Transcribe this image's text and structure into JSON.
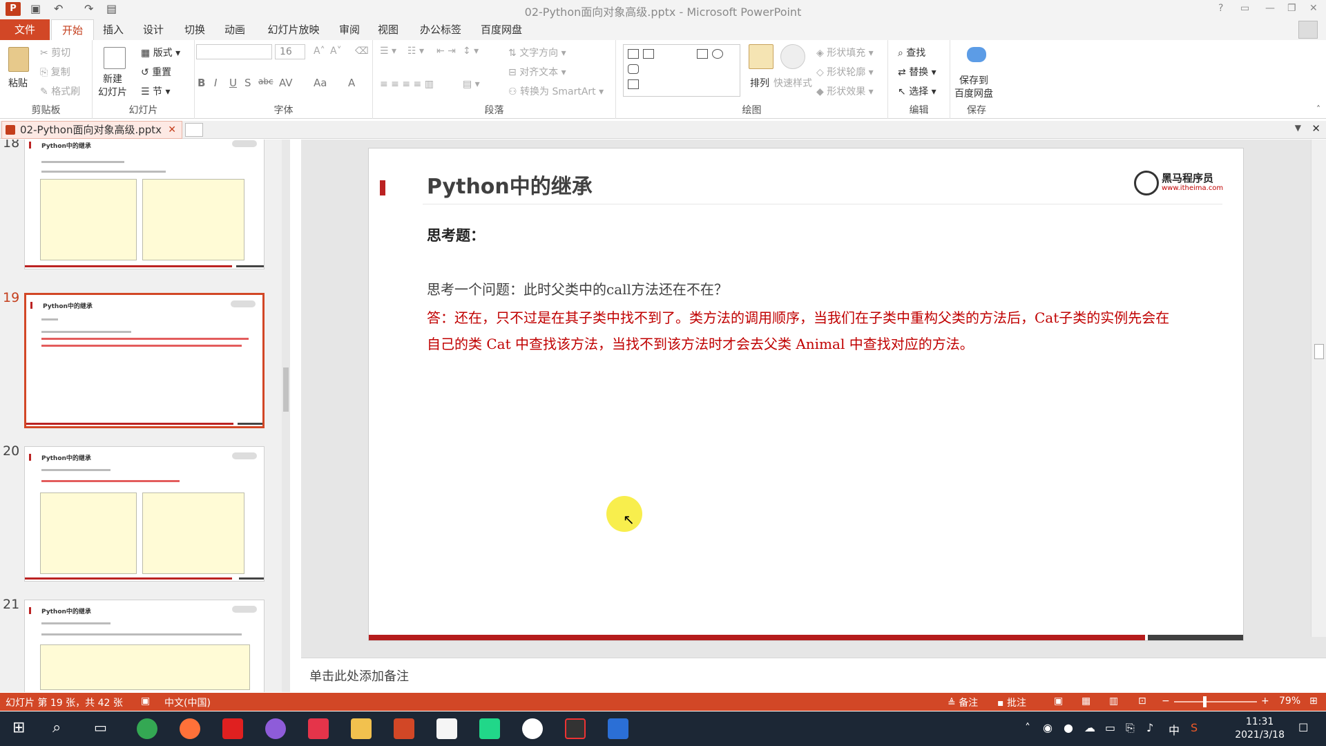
{
  "window": {
    "title": "02-Python面向对象高级.pptx - Microsoft PowerPoint",
    "help": "?"
  },
  "tabs": [
    "文件",
    "开始",
    "插入",
    "设计",
    "切换",
    "动画",
    "幻灯片放映",
    "审阅",
    "视图",
    "办公标签",
    "百度网盘"
  ],
  "ribbon": {
    "clipboard": {
      "paste": "粘贴",
      "cut": "剪切",
      "copy": "复制",
      "format_painter": "格式刷",
      "label": "剪贴板"
    },
    "slides": {
      "new_slide": "新建\n幻灯片",
      "layout": "版式",
      "reset": "重置",
      "section": "节",
      "label": "幻灯片"
    },
    "font": {
      "size": "16",
      "label": "字体",
      "bold": "B",
      "italic": "I",
      "underline": "U",
      "shadow": "S",
      "strike": "abc",
      "spacing": "AV",
      "case": "Aa",
      "color": "A"
    },
    "paragraph": {
      "text_direction": "文字方向",
      "align_text": "对齐文本",
      "smartart": "转换为 SmartArt",
      "label": "段落"
    },
    "drawing": {
      "arrange": "排列",
      "quick_styles": "快速样式",
      "shape_fill": "形状填充",
      "shape_outline": "形状轮廓",
      "shape_effects": "形状效果",
      "label": "绘图"
    },
    "editing": {
      "find": "查找",
      "replace": "替换",
      "select": "选择",
      "label": "编辑"
    },
    "save": {
      "save_baidu": "保存到\n百度网盘",
      "label": "保存"
    }
  },
  "doc_tab": {
    "name": "02-Python面向对象高级.pptx"
  },
  "thumbnails": [
    {
      "num": "18",
      "title": "Python中的继承"
    },
    {
      "num": "19",
      "title": "Python中的继承"
    },
    {
      "num": "20",
      "title": "Python中的继承"
    },
    {
      "num": "21",
      "title": "Python中的继承"
    }
  ],
  "slide": {
    "title": "Python中的继承",
    "subtitle": "思考题：",
    "question": "思考一个问题：此时父类中的call方法还在不在？",
    "answer": "答：还在，只不过是在其子类中找不到了。类方法的调用顺序，当我们在子类中重构父类的方法后，Cat子类的实例先会在自己的类 Cat 中查找该方法，当找不到该方法时才会去父类 Animal 中查找对应的方法。",
    "logo_text": "黑马程序员",
    "logo_url": "www.itheima.com"
  },
  "notes_placeholder": "单击此处添加备注",
  "status": {
    "slide_info": "幻灯片 第 19 张，共 42 张",
    "language": "中文(中国)",
    "notes": "备注",
    "comments": "批注",
    "zoom": "79%"
  },
  "taskbar": {
    "time": "11:31",
    "date": "2021/3/18",
    "ime": "中"
  },
  "colors": {
    "accent": "#d24726",
    "slide_red": "#c00000"
  }
}
